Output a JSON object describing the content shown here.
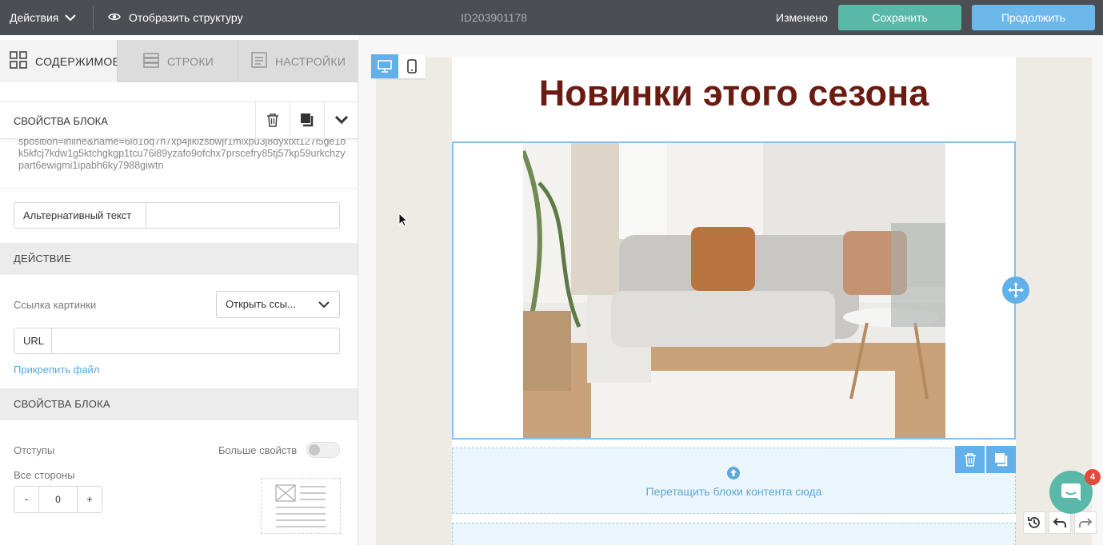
{
  "topbar": {
    "actions_label": "Действия",
    "structure_label": "Отобразить структуру",
    "doc_id": "ID203901178",
    "status": "Изменено",
    "save_label": "Сохранить",
    "continue_label": "Продолжить"
  },
  "tabs": [
    {
      "label": "СОДЕРЖИМОЕ"
    },
    {
      "label": "СТРОКИ"
    },
    {
      "label": "НАСТРОЙКИ"
    }
  ],
  "block_panel": {
    "title": "СВОЙСТВА БЛОКА",
    "url_text": "sposition=inline&name=6lo1oq7h7xp4jiklzsbwjr1mlxpu3j8dyxtxt127l5ge1ok5kfcj7kdw1g5ktchgkgp1tcu76i89yzafo9ofchx7prscefry85tj57kp59urkchzypart6ewigmi1ipabh6ky7988giwtn",
    "alt_text_label": "Альтернативный текст",
    "alt_text_value": ""
  },
  "action_section": {
    "title": "ДЕЙСТВИЕ",
    "link_label": "Ссылка картинки",
    "link_select_value": "Открыть ссы...",
    "url_label": "URL",
    "url_value": "",
    "attach_label": "Прикрепить файл"
  },
  "block_props": {
    "title": "СВОЙСТВА БЛОКА",
    "padding_label": "Отступы",
    "more_props_label": "Больше свойств",
    "all_sides_label": "Все стороны",
    "padding_value": "0",
    "minus": "-",
    "plus": "+"
  },
  "canvas": {
    "heading": "Новинки этого сезона",
    "drop_text": "Перетащить блоки контента сюда",
    "chat_badge": "4"
  },
  "colors": {
    "topbar_bg": "#4b4f54",
    "save": "#5ab8a8",
    "continue": "#6cb8ea",
    "heading": "#6b1c12",
    "accent": "#62b0ea"
  }
}
